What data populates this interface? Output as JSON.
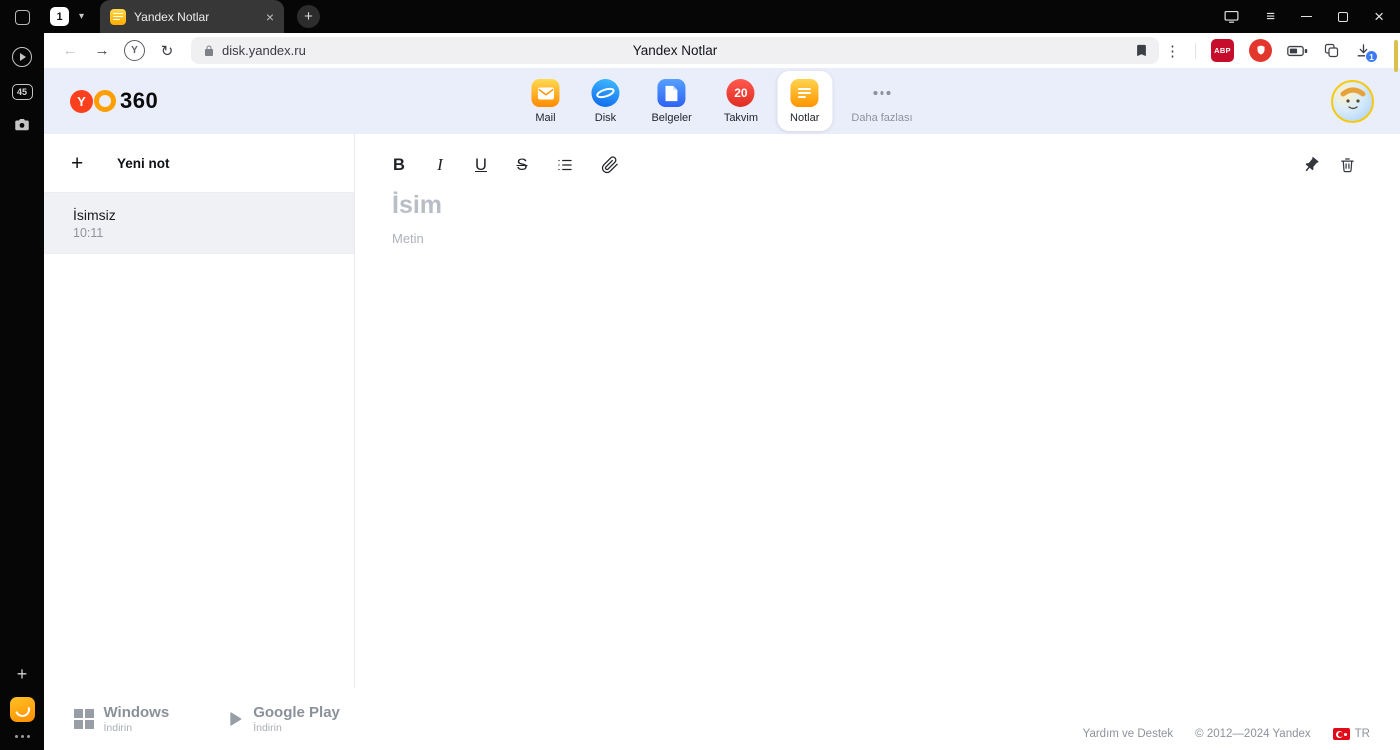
{
  "window": {
    "tab_count": "1",
    "chevron_glyph": "▾",
    "tab_title": "Yandex Notlar",
    "tab_close_glyph": "×",
    "new_tab_glyph": "+",
    "menu_glyph": "≡",
    "close_glyph": "×"
  },
  "rail": {
    "tabs_badge": "45",
    "plus_glyph": "+"
  },
  "toolbar": {
    "back_glyph": "←",
    "forward_glyph": "→",
    "yandex_glyph": "Y",
    "reload_glyph": "↻",
    "url": "disk.yandex.ru",
    "page_title": "Yandex Notlar",
    "menu_glyph": "⋮",
    "abp_label": "ABP",
    "download_badge": "1"
  },
  "header": {
    "logo_y": "Y",
    "logo_360": "360",
    "nav": [
      {
        "label": "Mail"
      },
      {
        "label": "Disk"
      },
      {
        "label": "Belgeler"
      },
      {
        "label": "Takvim",
        "badge": "20"
      },
      {
        "label": "Notlar"
      },
      {
        "label": "Daha fazlası"
      }
    ]
  },
  "notes": {
    "plus_glyph": "+",
    "new_note_label": "Yeni not",
    "items": [
      {
        "title": "İsimsiz",
        "time": "10:11"
      }
    ]
  },
  "editor": {
    "bold_glyph": "B",
    "italic_glyph": "I",
    "underline_glyph": "U",
    "strike_glyph": "S",
    "title_placeholder": "İsim",
    "body_placeholder": "Metin"
  },
  "footer": {
    "windows_title": "Windows",
    "windows_sub": "İndirin",
    "gplay_title": "Google Play",
    "gplay_sub": "İndirin",
    "help_label": "Yardım ve Destek",
    "copyright": "© 2012—2024 Yandex",
    "lang_label": "TR"
  },
  "colors": {
    "header_bg": "#eaeefa",
    "yandex_red": "#fc3f1d",
    "yandex_orange": "#ff9e00",
    "notes_yellow": "#ffb000",
    "selected_note_bg": "#f0f1f4",
    "download_badge_blue": "#3c7bf6"
  }
}
